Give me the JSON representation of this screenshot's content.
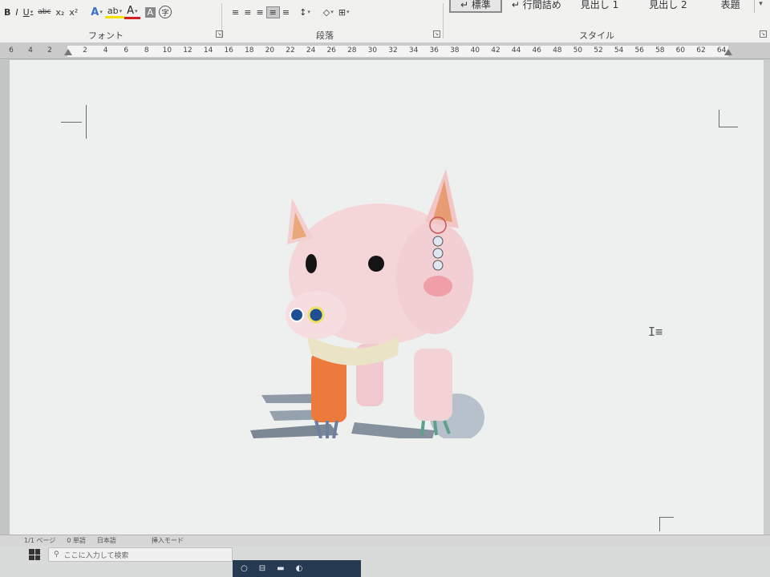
{
  "ribbon": {
    "font_row": [
      "B",
      "I",
      "U",
      "abc",
      "x₂",
      "x²"
    ],
    "font_row2": [
      "A",
      "ab",
      "A",
      "A",
      "字"
    ],
    "para_row": [
      "≡",
      "≡",
      "≡",
      "≡",
      "≡",
      "↕",
      "◇",
      "⊞"
    ],
    "font_group_label": "フォント",
    "para_group_label": "段落",
    "style_group_label": "スタイル",
    "styles": [
      "↵ 標準",
      "↵ 行間詰め",
      "見出し 1",
      "見出し 2",
      "表題"
    ]
  },
  "ruler": {
    "left_numbers": [
      "6",
      "4",
      "2"
    ],
    "numbers": [
      "2",
      "4",
      "6",
      "8",
      "10",
      "12",
      "14",
      "16",
      "18",
      "20",
      "22",
      "24",
      "26",
      "28",
      "30",
      "32",
      "34",
      "36",
      "38",
      "40",
      "42",
      "44",
      "46",
      "48",
      "50",
      "52",
      "54",
      "56",
      "58",
      "60",
      "62",
      "64"
    ]
  },
  "status": {
    "items": [
      "1/1 ページ",
      "0 単語",
      "日本語",
      "挿入モード"
    ]
  },
  "taskbar": {
    "search_placeholder": "ここに入力して検索"
  },
  "icons": {
    "start": "windows-icon",
    "search": "search-icon",
    "cursor": "text-cursor-icon"
  },
  "colors": {
    "pig_body": "#f4d6d8",
    "pig_ear_inner": "#e9a77a",
    "pig_leg": "#e8793a",
    "shadow": "#8c98a6",
    "cheek": "#ef8f9a",
    "taskbar_strip": "#263b52"
  }
}
